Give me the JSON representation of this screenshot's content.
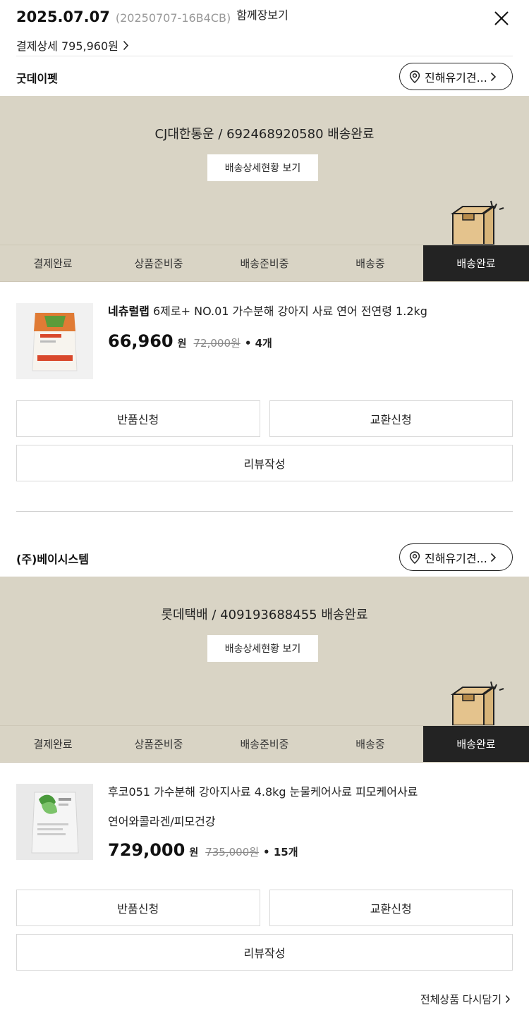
{
  "header": {
    "order_date": "2025.07.07",
    "order_no": "(20250707-16B4CB)",
    "together_label": "함께장보기",
    "payment_detail_label": "결제상세 795,960원"
  },
  "steps": [
    "결제완료",
    "상품준비중",
    "배송준비중",
    "배송중",
    "배송완료"
  ],
  "orders": [
    {
      "seller": "굿데이펫",
      "location_btn": "진해유기견...",
      "courier_line": "CJ대한통운 / 692468920580 배송완료",
      "detail_btn": "배송상세현황 보기",
      "active_step": "배송완료",
      "product": {
        "brand": "네츄럴랩",
        "name": "6제로+ NO.01 가수분해 강아지 사료 연어 전연령 1.2kg",
        "option": "",
        "price": "66,960",
        "won": "원",
        "original_price": "72,000원",
        "qty": "• 4개"
      },
      "buttons": {
        "return": "반품신청",
        "exchange": "교환신청",
        "review": "리뷰작성"
      }
    },
    {
      "seller": "(주)베이시스템",
      "location_btn": "진해유기견...",
      "courier_line": "롯데택배 / 409193688455 배송완료",
      "detail_btn": "배송상세현황 보기",
      "active_step": "배송완료",
      "product": {
        "brand": "",
        "name": "후코051 가수분해 강아지사료 4.8kg 눈물케어사료 피모케어사료",
        "option": "연어와콜라겐/피모건강",
        "price": "729,000",
        "won": "원",
        "original_price": "735,000원",
        "qty": "• 15개"
      },
      "buttons": {
        "return": "반품신청",
        "exchange": "교환신청",
        "review": "리뷰작성"
      }
    }
  ],
  "footer": {
    "reorder_all": "전체상품 다시담기"
  },
  "colors": {
    "panel_bg": "#d9d4c5",
    "active_step_bg": "#232323",
    "box_color": "#e4c38d"
  }
}
